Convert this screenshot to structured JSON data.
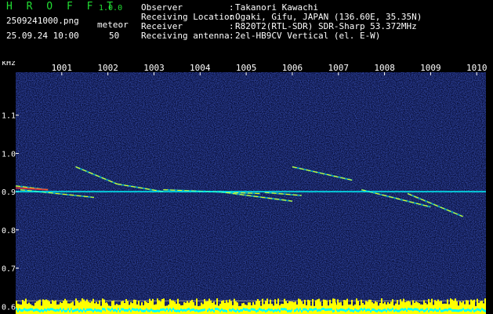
{
  "app": {
    "title": "H R O F F T",
    "version": "1.0.0",
    "file_name": "2509241000.png",
    "datetime": "25.09.24 10:00",
    "meteor_label": "meteor",
    "meteor_count": "50"
  },
  "info": [
    {
      "label": "Observer",
      "value": "Takanori Kawachi"
    },
    {
      "label": "Receiving Location",
      "value": "Ogaki, Gifu, JAPAN (136.60E, 35.35N)"
    },
    {
      "label": "Receiver",
      "value": "R820T2(RTL-SDR) SDR-Sharp 53.372MHz"
    },
    {
      "label": "Receiving antenna",
      "value": "2el-HB9CV Vertical (el. E-W)"
    }
  ],
  "colors": {
    "background": "#000000",
    "noise": "#1a2a8c",
    "title_green": "#22dd33",
    "signal_yellow": "#ffff00",
    "signal_cyan": "#00ffff",
    "signal_red": "#ff3030"
  },
  "chart_data": {
    "type": "heatmap",
    "ylabel": "kHz",
    "y_ticks": [
      {
        "label": "1.1",
        "value": 1.1
      },
      {
        "label": "1.0",
        "value": 1.0
      },
      {
        "label": "0.9",
        "value": 0.9
      },
      {
        "label": "0.8",
        "value": 0.8
      },
      {
        "label": "0.7",
        "value": 0.7
      },
      {
        "label": "0.6",
        "value": 0.6
      }
    ],
    "ylim": [
      0.58,
      1.2
    ],
    "x_ticks": [
      "1001",
      "1002",
      "1003",
      "1004",
      "1005",
      "1006",
      "1007",
      "1008",
      "1009",
      "1010"
    ],
    "xlim": [
      1000,
      1010.2
    ],
    "carrier_khz": 0.9,
    "meteor_traces": [
      {
        "t0": 1000.0,
        "f0": 0.915,
        "t1": 1000.7,
        "f1": 0.905
      },
      {
        "t0": 1000.1,
        "f0": 0.905,
        "t1": 1001.7,
        "f1": 0.885
      },
      {
        "t0": 1001.3,
        "f0": 0.965,
        "t1": 1002.2,
        "f1": 0.92
      },
      {
        "t0": 1002.2,
        "f0": 0.92,
        "t1": 1003.2,
        "f1": 0.9
      },
      {
        "t0": 1003.2,
        "f0": 0.905,
        "t1": 1005.3,
        "f1": 0.895
      },
      {
        "t0": 1004.4,
        "f0": 0.9,
        "t1": 1006.0,
        "f1": 0.875
      },
      {
        "t0": 1006.0,
        "f0": 0.965,
        "t1": 1007.3,
        "f1": 0.93
      },
      {
        "t0": 1007.5,
        "f0": 0.905,
        "t1": 1009.0,
        "f1": 0.86
      },
      {
        "t0": 1008.5,
        "f0": 0.895,
        "t1": 1009.7,
        "f1": 0.835
      },
      {
        "t0": 1005.4,
        "f0": 0.898,
        "t1": 1006.2,
        "f1": 0.89
      }
    ]
  }
}
